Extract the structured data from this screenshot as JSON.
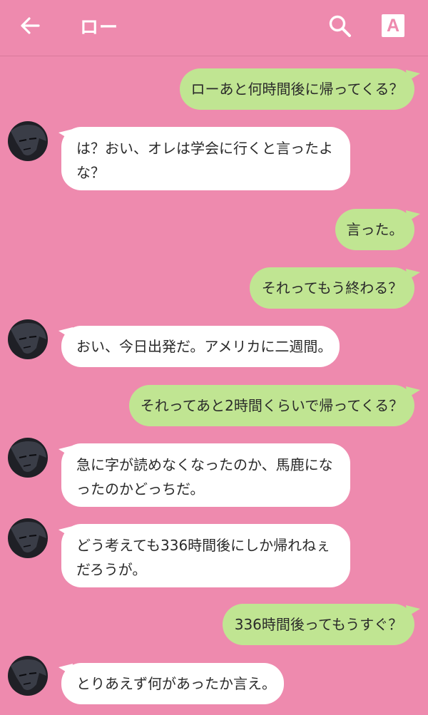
{
  "header": {
    "title": "ロー",
    "font_button_label": "A",
    "icons": [
      "back-arrow-icon",
      "search-icon",
      "font-size-icon"
    ]
  },
  "colors": {
    "background": "#ee8aae",
    "outgoing_bubble": "#c0e592",
    "incoming_bubble": "#ffffff"
  },
  "messages": [
    {
      "side": "out",
      "text": "ローあと何時間後に帰ってくる？"
    },
    {
      "side": "in",
      "text": "は？おい、オレは学会に行くと言ったよな？"
    },
    {
      "side": "out",
      "text": "言った。"
    },
    {
      "side": "out",
      "text": "それってもう終わる？"
    },
    {
      "side": "in",
      "text": "おい、今日出発だ。アメリカに二週間。"
    },
    {
      "side": "out",
      "text": "それってあと2時間くらいで帰ってくる？"
    },
    {
      "side": "in",
      "text": "急に字が読めなくなったのか、馬鹿になったのかどっちだ。"
    },
    {
      "side": "in",
      "text": "どう考えても336時間後にしか帰れねぇだろうが。"
    },
    {
      "side": "out",
      "text": "336時間後ってもうすぐ？"
    },
    {
      "side": "in",
      "text": "とりあえず何があったか言え。"
    }
  ]
}
